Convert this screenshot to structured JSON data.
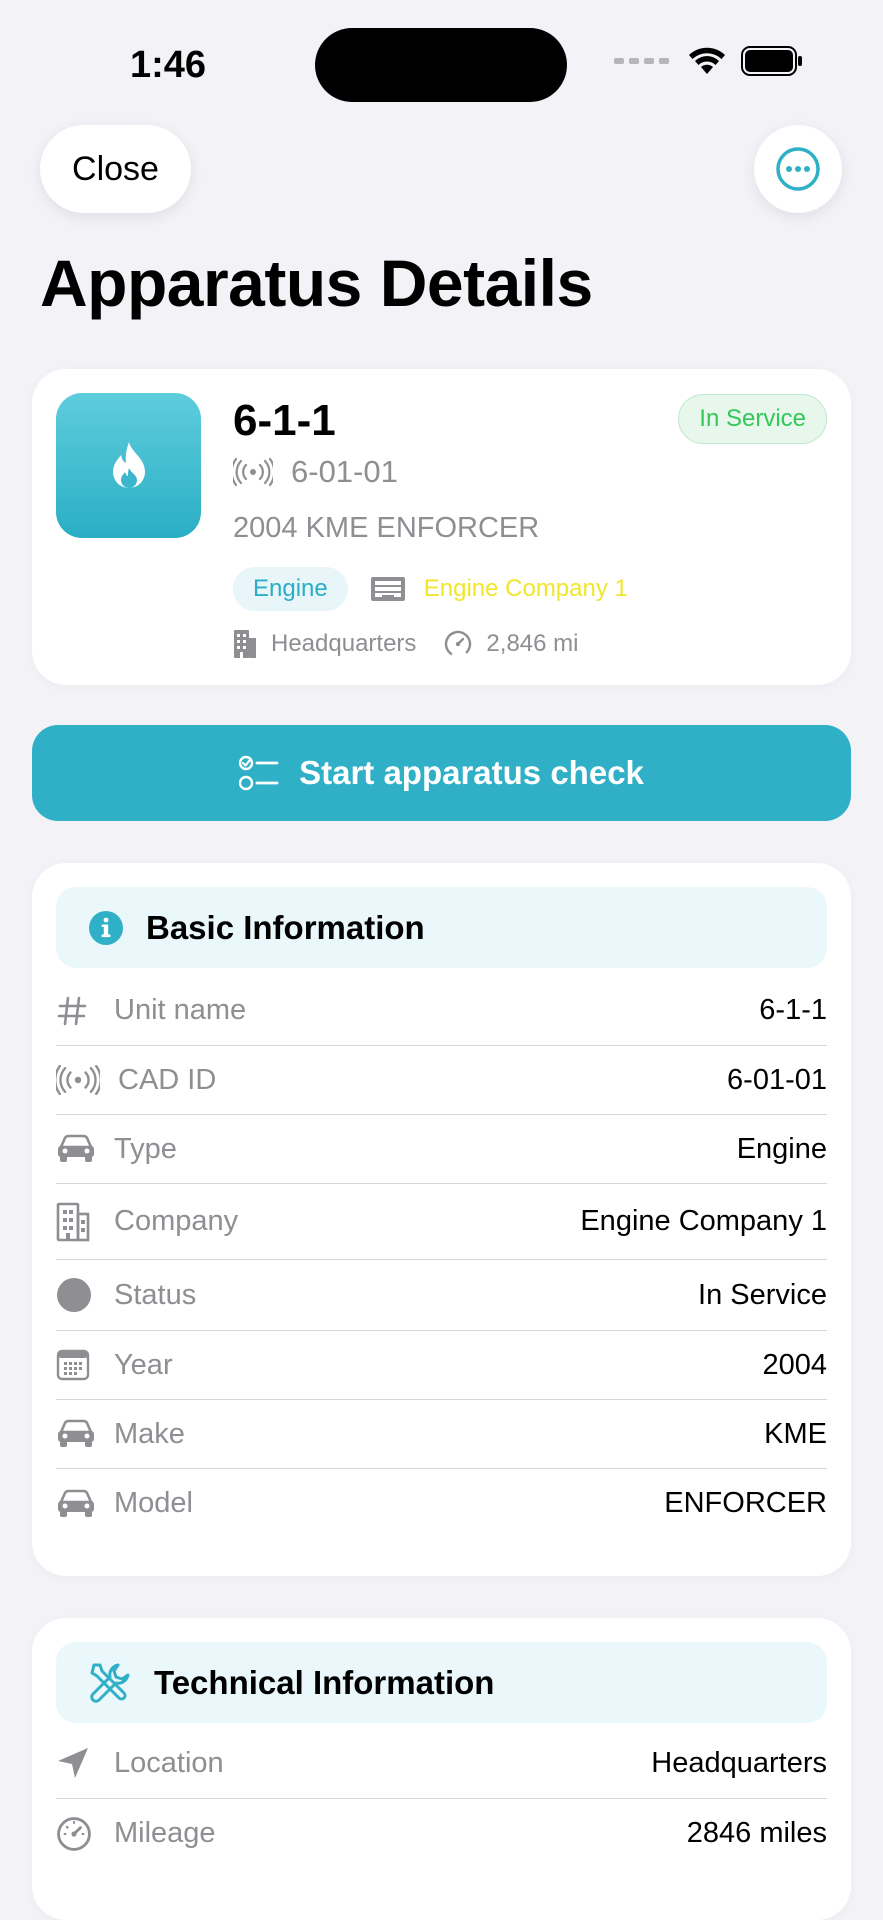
{
  "status_bar": {
    "time": "1:46"
  },
  "header": {
    "close_label": "Close",
    "title": "Apparatus Details"
  },
  "summary": {
    "unit_name": "6-1-1",
    "cad_id": "6-01-01",
    "description": "2004 KME ENFORCER",
    "status": "In Service",
    "type": "Engine",
    "company": "Engine Company 1",
    "location": "Headquarters",
    "mileage": "2,846 mi"
  },
  "actions": {
    "start_check": "Start apparatus check"
  },
  "basic_info": {
    "title": "Basic Information",
    "rows": [
      {
        "icon": "hash-icon",
        "label": "Unit name",
        "value": "6-1-1"
      },
      {
        "icon": "antenna-icon",
        "label": "CAD ID",
        "value": "6-01-01"
      },
      {
        "icon": "car-icon",
        "label": "Type",
        "value": "Engine"
      },
      {
        "icon": "building-icon",
        "label": "Company",
        "value": "Engine Company 1"
      },
      {
        "icon": "status-dot-icon",
        "label": "Status",
        "value": "In Service"
      },
      {
        "icon": "calendar-icon",
        "label": "Year",
        "value": "2004"
      },
      {
        "icon": "car-icon",
        "label": "Make",
        "value": "KME"
      },
      {
        "icon": "car-icon",
        "label": "Model",
        "value": "ENFORCER"
      }
    ]
  },
  "technical_info": {
    "title": "Technical Information",
    "rows": [
      {
        "icon": "location-arrow-icon",
        "label": "Location",
        "value": "Headquarters"
      },
      {
        "icon": "speedometer-icon",
        "label": "Mileage",
        "value": "2846 miles"
      }
    ]
  },
  "colors": {
    "accent": "#30b0c7",
    "status_green": "#34c759",
    "company_yellow": "#f0e62a",
    "secondary_text": "#8e8e93"
  }
}
